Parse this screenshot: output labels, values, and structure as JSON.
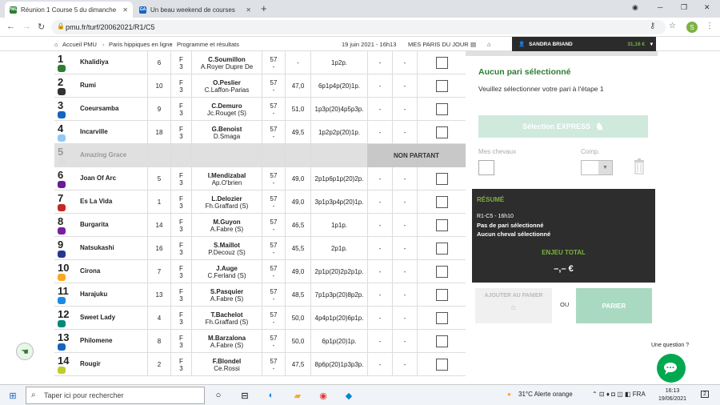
{
  "browser": {
    "tabs": [
      {
        "title": "Réunion 1 Course 5 du dimanche",
        "favicon": "PMU"
      },
      {
        "title": "Un beau weekend de courses",
        "favicon": "GA"
      }
    ],
    "url": "pmu.fr/turf/20062021/R1/C5"
  },
  "pmu_header": {
    "breadcrumb": [
      "Accueil PMU",
      "Paris hippiques en ligne",
      "Programme et résultats"
    ],
    "datetime": "19 juin 2021 - 16h13",
    "mes_paris": "MES PARIS DU JOUR",
    "user": "SANDRA BRIAND",
    "balance": "31,16 €"
  },
  "runners": [
    {
      "num": "1",
      "name": "Khalidiya",
      "corde": "6",
      "sexe": "F",
      "age": "3",
      "jockey": "C.Soumillon",
      "trainer": "A.Royer Dupre De",
      "poids": "57",
      "poids2": "-",
      "cote": "-",
      "musique": "1p2p.",
      "d1": "-",
      "d2": "-",
      "silk": "#2e7d32",
      "np": false
    },
    {
      "num": "2",
      "name": "Rumi",
      "corde": "10",
      "sexe": "F",
      "age": "3",
      "jockey": "O.Peslier",
      "trainer": "C.Laffon-Parias",
      "poids": "57",
      "poids2": "-",
      "cote": "47,0",
      "musique": "6p1p4p(20)1p.",
      "d1": "-",
      "d2": "-",
      "silk": "#333333",
      "np": false
    },
    {
      "num": "3",
      "name": "Coeursamba",
      "corde": "9",
      "sexe": "F",
      "age": "3",
      "jockey": "C.Demuro",
      "trainer": "Jc.Rouget (S)",
      "poids": "57",
      "poids2": "-",
      "cote": "51,0",
      "musique": "1p3p(20)4p5p3p.",
      "d1": "-",
      "d2": "-",
      "silk": "#1565c0",
      "np": false
    },
    {
      "num": "4",
      "name": "Incarville",
      "corde": "18",
      "sexe": "F",
      "age": "3",
      "jockey": "G.Benoist",
      "trainer": "D.Smaga",
      "poids": "57",
      "poids2": "-",
      "cote": "49,5",
      "musique": "1p2p2p(20)1p.",
      "d1": "-",
      "d2": "-",
      "silk": "#90caf9",
      "np": false
    },
    {
      "num": "5",
      "name": "Amazing Grace",
      "corde": "",
      "sexe": "",
      "age": "",
      "jockey": "",
      "trainer": "",
      "poids": "",
      "poids2": "",
      "cote": "",
      "musique": "",
      "d1": "",
      "d2": "",
      "silk": "#dddddd",
      "np": true,
      "np_label": "NON PARTANT"
    },
    {
      "num": "6",
      "name": "Joan Of Arc",
      "corde": "5",
      "sexe": "F",
      "age": "3",
      "jockey": "I.Mendizabal",
      "trainer": "Ap.O'brien",
      "poids": "57",
      "poids2": "-",
      "cote": "49,0",
      "musique": "2p1p6p1p(20)2p.",
      "d1": "-",
      "d2": "-",
      "silk": "#6a1b9a",
      "np": false
    },
    {
      "num": "7",
      "name": "Es La Vida",
      "corde": "1",
      "sexe": "F",
      "age": "3",
      "jockey": "L.Delozier",
      "trainer": "Fh.Graffard (S)",
      "poids": "57",
      "poids2": "-",
      "cote": "49,0",
      "musique": "3p1p3p4p(20)1p.",
      "d1": "-",
      "d2": "-",
      "silk": "#c62828",
      "np": false
    },
    {
      "num": "8",
      "name": "Burgarita",
      "corde": "14",
      "sexe": "F",
      "age": "3",
      "jockey": "M.Guyon",
      "trainer": "A.Fabre (S)",
      "poids": "57",
      "poids2": "-",
      "cote": "46,5",
      "musique": "1p1p.",
      "d1": "-",
      "d2": "-",
      "silk": "#7b1fa2",
      "np": false
    },
    {
      "num": "9",
      "name": "Natsukashi",
      "corde": "16",
      "sexe": "F",
      "age": "3",
      "jockey": "S.Maillot",
      "trainer": "P.Decouz (S)",
      "poids": "57",
      "poids2": "-",
      "cote": "45,5",
      "musique": "2p1p.",
      "d1": "-",
      "d2": "-",
      "silk": "#283593",
      "np": false
    },
    {
      "num": "10",
      "name": "Cirona",
      "corde": "7",
      "sexe": "F",
      "age": "3",
      "jockey": "J.Auge",
      "trainer": "C.Ferland (S)",
      "poids": "57",
      "poids2": "-",
      "cote": "49,0",
      "musique": "2p1p(20)2p2p1p.",
      "d1": "-",
      "d2": "-",
      "silk": "#f9a825",
      "np": false
    },
    {
      "num": "11",
      "name": "Harajuku",
      "corde": "13",
      "sexe": "F",
      "age": "3",
      "jockey": "S.Pasquier",
      "trainer": "A.Fabre (S)",
      "poids": "57",
      "poids2": "-",
      "cote": "48,5",
      "musique": "7p1p3p(20)8p2p.",
      "d1": "-",
      "d2": "-",
      "silk": "#1e88e5",
      "np": false
    },
    {
      "num": "12",
      "name": "Sweet Lady",
      "corde": "4",
      "sexe": "F",
      "age": "3",
      "jockey": "T.Bachelot",
      "trainer": "Fh.Graffard (S)",
      "poids": "57",
      "poids2": "-",
      "cote": "50,0",
      "musique": "4p4p1p(20)6p1p.",
      "d1": "-",
      "d2": "-",
      "silk": "#00897b",
      "np": false
    },
    {
      "num": "13",
      "name": "Philomene",
      "corde": "8",
      "sexe": "F",
      "age": "3",
      "jockey": "M.Barzalona",
      "trainer": "A.Fabre (S)",
      "poids": "57",
      "poids2": "-",
      "cote": "50,0",
      "musique": "6p1p(20)1p.",
      "d1": "-",
      "d2": "-",
      "silk": "#1565c0",
      "np": false
    },
    {
      "num": "14",
      "name": "Rougir",
      "corde": "2",
      "sexe": "F",
      "age": "3",
      "jockey": "F.Blondel",
      "trainer": "Ce.Rossi",
      "poids": "57",
      "poids2": "-",
      "cote": "47,5",
      "musique": "8p6p(20)1p3p3p.",
      "d1": "-",
      "d2": "-",
      "silk": "#c0ca33",
      "np": false
    }
  ],
  "bet_panel": {
    "title": "Aucun pari sélectionné",
    "subtitle": "Veuillez sélectionner votre pari à l'étape 1",
    "express": "Sélection EXPRESS",
    "mes_chevaux": "Mes chevaux",
    "comp": "Comp.",
    "resume": {
      "title": "RÉSUMÉ",
      "race": "R1-C5 - 16h10",
      "line1": "Pas de pari sélectionné",
      "line2": "Aucun cheval sélectionné",
      "enjeu_label": "ENJEU TOTAL",
      "enjeu_value": "–,– €"
    },
    "panier": "AJOUTER AU PANIER",
    "ou": "OU",
    "parier": "PARIER"
  },
  "help": {
    "question": "Une question ?"
  },
  "taskbar": {
    "search_placeholder": "Taper ici pour rechercher",
    "weather": "31°C  Alerte orange",
    "time": "16:13",
    "date": "19/06/2021",
    "notif_count": "2"
  }
}
